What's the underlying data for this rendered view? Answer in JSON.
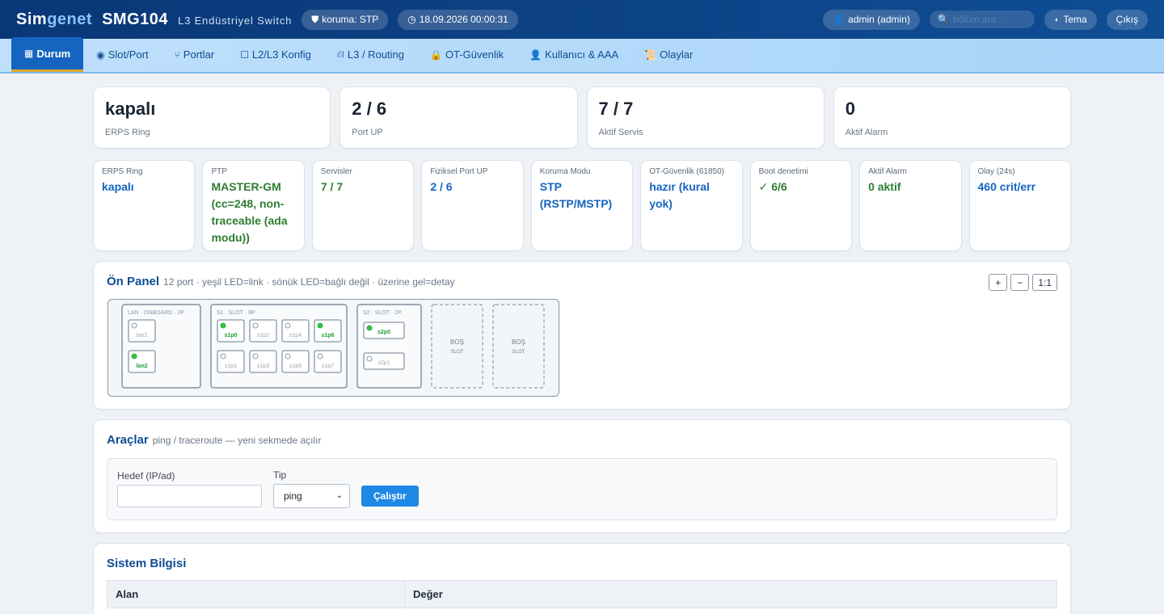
{
  "header": {
    "brand_part1": "Sim",
    "brand_part2": "genet",
    "model": "SMG104",
    "subtitle": "L3 Endüstriyel Switch",
    "protection_pill": "koruma: STP",
    "datetime_pill": "18.09.2026 00:00:31",
    "user_pill": "admin (admin)",
    "search_placeholder": "bölüm ara...",
    "theme_label": "Tema",
    "logout_label": "Çıkış"
  },
  "tabs": [
    {
      "label": "Durum",
      "icon": "building-icon",
      "glyph": "▦",
      "active": true
    },
    {
      "label": "Slot/Port",
      "icon": "target-icon",
      "glyph": "◉"
    },
    {
      "label": "Portlar",
      "icon": "plug-icon",
      "glyph": "⑂"
    },
    {
      "label": "L2/L3 Konfig",
      "icon": "square-icon",
      "glyph": "☐"
    },
    {
      "label": "L3 / Routing",
      "icon": "router-icon",
      "glyph": "⛜"
    },
    {
      "label": "OT-Güvenlik",
      "icon": "lock-icon",
      "glyph": "🔒"
    },
    {
      "label": "Kullanıcı & AAA",
      "icon": "user-icon",
      "glyph": "👤"
    },
    {
      "label": "Olaylar",
      "icon": "scroll-icon",
      "glyph": "📜"
    }
  ],
  "summary": [
    {
      "value": "kapalı",
      "label": "ERPS Ring"
    },
    {
      "value": "2 / 6",
      "label": "Port UP"
    },
    {
      "value": "7 / 7",
      "label": "Aktif Servis"
    },
    {
      "value": "0",
      "label": "Aktif Alarm"
    }
  ],
  "status_cards": [
    {
      "label": "ERPS Ring",
      "value": "kapalı",
      "color": "blue"
    },
    {
      "label": "PTP",
      "value": "MASTER-GM (cc=248, non-traceable (ada modu))",
      "color": "green"
    },
    {
      "label": "Servisler",
      "value": "7 / 7",
      "color": "green"
    },
    {
      "label": "Fiziksel Port UP",
      "value": "2 / 6",
      "color": "blue"
    },
    {
      "label": "Koruma Modu",
      "value": "STP (RSTP/MSTP)",
      "color": "blue"
    },
    {
      "label": "OT-Güvenlik (61850)",
      "value": "hazır (kural yok)",
      "color": "blue"
    },
    {
      "label": "Boot denetimi",
      "value": "✓ 6/6",
      "color": "green"
    },
    {
      "label": "Aktif Alarm",
      "value": "0 aktif",
      "color": "green"
    },
    {
      "label": "Olay (24s)",
      "value": "460 crit/err",
      "color": "blue"
    }
  ],
  "front_panel": {
    "title": "Ön Panel",
    "hint": "12 port · yeşil LED=link · sönük LED=bağlı değil · üzerine gel=detay",
    "zoom_in": "+",
    "zoom_out": "−",
    "zoom_reset": "1:1",
    "modules": [
      {
        "title": "LAN · ONBOARD · 2P",
        "ports": [
          {
            "name": "lan1",
            "up": false
          },
          {
            "name": "lan2",
            "up": true
          }
        ]
      },
      {
        "title": "S1 · SLOT · 8P",
        "ports": [
          {
            "name": "s1p0",
            "up": true
          },
          {
            "name": "s1p2",
            "up": false
          },
          {
            "name": "s1p4",
            "up": false
          },
          {
            "name": "s1p6",
            "up": true
          },
          {
            "name": "s1p1",
            "up": false
          },
          {
            "name": "s1p3",
            "up": false
          },
          {
            "name": "s1p5",
            "up": false
          },
          {
            "name": "s1p7",
            "up": false
          }
        ]
      },
      {
        "title": "S2 · SLOT · 2P",
        "ports": [
          {
            "name": "s2p0",
            "up": true
          },
          {
            "name": "s2p1",
            "up": false
          }
        ]
      }
    ],
    "empty_slot_line1": "BOŞ",
    "empty_slot_line2": "SLOT",
    "colors": {
      "led_on": "#2ecc40",
      "led_off": "#ffffff",
      "frame": "#6b7a8a"
    }
  },
  "tools": {
    "title": "Araçlar",
    "hint": "ping / traceroute — yeni sekmede açılır",
    "target_label": "Hedef (IP/ad)",
    "target_value": "",
    "type_label": "Tip",
    "type_value": "ping",
    "run_label": "Çalıştır"
  },
  "system_info": {
    "title": "Sistem Bilgisi",
    "col_field": "Alan",
    "col_value": "Değer"
  }
}
